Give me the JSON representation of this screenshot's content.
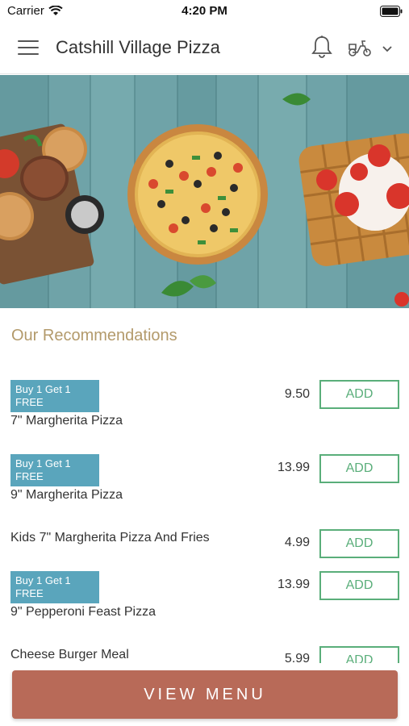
{
  "status_bar": {
    "carrier": "Carrier",
    "time": "4:20 PM"
  },
  "header": {
    "title": "Catshill Village Pizza"
  },
  "section": {
    "title": "Our Recommendations"
  },
  "items": [
    {
      "badge": "Buy 1 Get 1 FREE",
      "name": "7\" Margherita Pizza",
      "price": "9.50",
      "add_label": "ADD"
    },
    {
      "badge": "Buy 1 Get 1 FREE",
      "name": "9\" Margherita Pizza",
      "price": "13.99",
      "add_label": "ADD"
    },
    {
      "badge": "",
      "name": "Kids 7\" Margherita Pizza And Fries",
      "price": "4.99",
      "add_label": "ADD"
    },
    {
      "badge": "Buy 1 Get 1 FREE",
      "name": "9\" Pepperoni Feast Pizza",
      "price": "13.99",
      "add_label": "ADD"
    },
    {
      "badge": "",
      "name": "Cheese Burger Meal",
      "price": "5.99",
      "add_label": "ADD"
    }
  ],
  "footer": {
    "view_menu_label": "VIEW MENU"
  },
  "colors": {
    "accent": "#b86a58",
    "badge": "#5aa5bc",
    "add_green": "#5aae7a",
    "section_title": "#b39a6b"
  },
  "icons": [
    "menu-icon",
    "bell-icon",
    "scooter-icon",
    "chevron-down-icon",
    "wifi-icon",
    "battery-icon"
  ]
}
